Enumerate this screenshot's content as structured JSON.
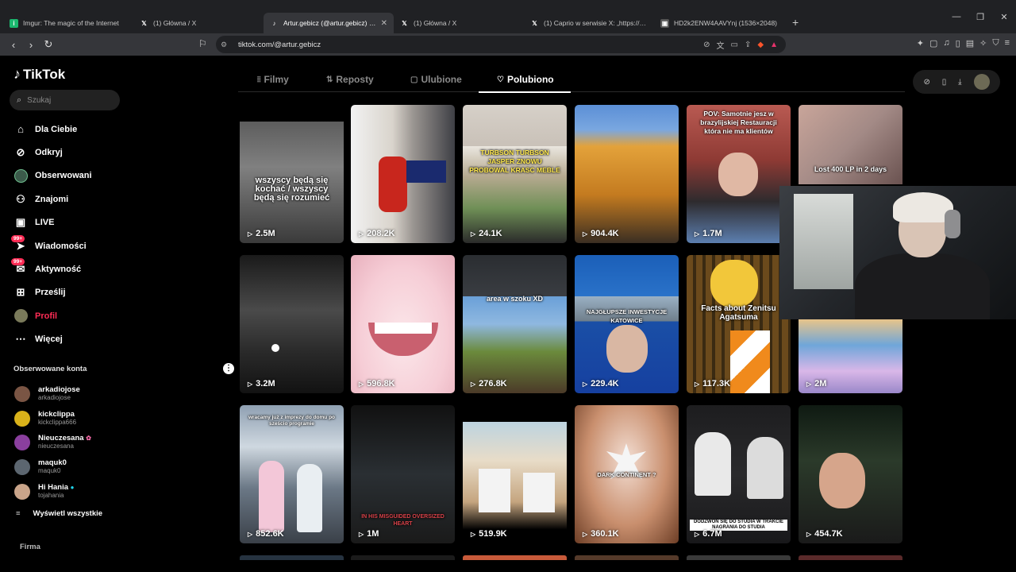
{
  "browser": {
    "tabs": [
      {
        "title": "Imgur: The magic of the Internet",
        "icon": "imgur-icon",
        "active": false
      },
      {
        "title": "(1) Główna / X",
        "icon": "x-icon",
        "active": false
      },
      {
        "title": "Artur.gebicz (@artur.gebicz) | TikTok",
        "icon": "tiktok-icon",
        "active": true
      },
      {
        "title": "(1) Główna / X",
        "icon": "x-icon",
        "active": false
      },
      {
        "title": "(1) Caprio w serwisie X: „https://t.co/...",
        "icon": "x-icon",
        "active": false
      },
      {
        "title": "HD2k2ENW4AAVYnj (1536×2048)",
        "icon": "image-icon",
        "active": false
      }
    ],
    "url": "tiktok.com/@artur.gebicz"
  },
  "sidebar": {
    "logo": "TikTok",
    "search_placeholder": "Szukaj",
    "nav": [
      {
        "label": "Dla Ciebie",
        "icon": "home-icon"
      },
      {
        "label": "Odkryj",
        "icon": "compass-icon"
      },
      {
        "label": "Obserwowani",
        "icon": "following-avatar-icon"
      },
      {
        "label": "Znajomi",
        "icon": "friends-icon"
      },
      {
        "label": "LIVE",
        "icon": "live-icon"
      },
      {
        "label": "Wiadomości",
        "icon": "messages-icon",
        "badge": "99+"
      },
      {
        "label": "Aktywność",
        "icon": "activity-icon",
        "badge": "99+"
      },
      {
        "label": "Prześlij",
        "icon": "upload-icon"
      },
      {
        "label": "Profil",
        "icon": "profile-avatar-icon",
        "active": true
      },
      {
        "label": "Więcej",
        "icon": "more-icon"
      }
    ],
    "following_title": "Obserwowane konta",
    "following": [
      {
        "name": "arkadiojose",
        "username": "arkadiojose"
      },
      {
        "name": "kickclippa",
        "username": "kickclippa666"
      },
      {
        "name": "Nieuczesana",
        "username": "nieuczesana"
      },
      {
        "name": "maquk0",
        "username": "maquk0"
      },
      {
        "name": "Hi Hania",
        "username": "tojahania"
      }
    ],
    "show_all": "Wyświetl wszystkie",
    "company": "Firma"
  },
  "profile_tabs": [
    {
      "label": "Filmy",
      "icon": "grid-icon"
    },
    {
      "label": "Reposty",
      "icon": "repost-icon"
    },
    {
      "label": "Ulubione",
      "icon": "bookmark-icon"
    },
    {
      "label": "Polubiono",
      "icon": "heart-icon",
      "active": true
    }
  ],
  "videos": [
    {
      "views": "2.5M",
      "caption": "wszyscy będą się kochać / wszyscy będą się rozumieć"
    },
    {
      "views": "208.2K",
      "caption": ""
    },
    {
      "views": "24.1K",
      "caption": "TURBSON  TURBSON  JASPER ZNOWU PROBOWAL KRASC MEBLE"
    },
    {
      "views": "904.4K",
      "caption": ""
    },
    {
      "views": "1.7M",
      "caption": "POV: Samotnie jesz w brazylijskiej Restauracji która nie ma klientów"
    },
    {
      "views": "",
      "caption": "Lost 400 LP in 2 days"
    },
    {
      "views": "3.2M",
      "caption": ""
    },
    {
      "views": "596.8K",
      "caption": ""
    },
    {
      "views": "276.8K",
      "caption": "area w szoku XD"
    },
    {
      "views": "229.4K",
      "caption": "NAJGŁUPSZE INWESTYCJE KATOWICE"
    },
    {
      "views": "117.3K",
      "caption": "Facts about Zenitsu Agatsuma"
    },
    {
      "views": "2M",
      "caption": ""
    },
    {
      "views": "852.6K",
      "caption": "wracamy już z imprezy do domu po sześcio programie"
    },
    {
      "views": "1M",
      "caption": "IN HIS MISGUIDED OVERSIZED HEART"
    },
    {
      "views": "519.9K",
      "caption": ""
    },
    {
      "views": "360.1K",
      "caption": "DARK CONTINENT ?"
    },
    {
      "views": "6.7M",
      "caption": "DODZWOŃ SIĘ DO STUDIA W TRAKCIE NAGRANIA DO STUDIA"
    },
    {
      "views": "454.7K",
      "caption": ""
    }
  ]
}
